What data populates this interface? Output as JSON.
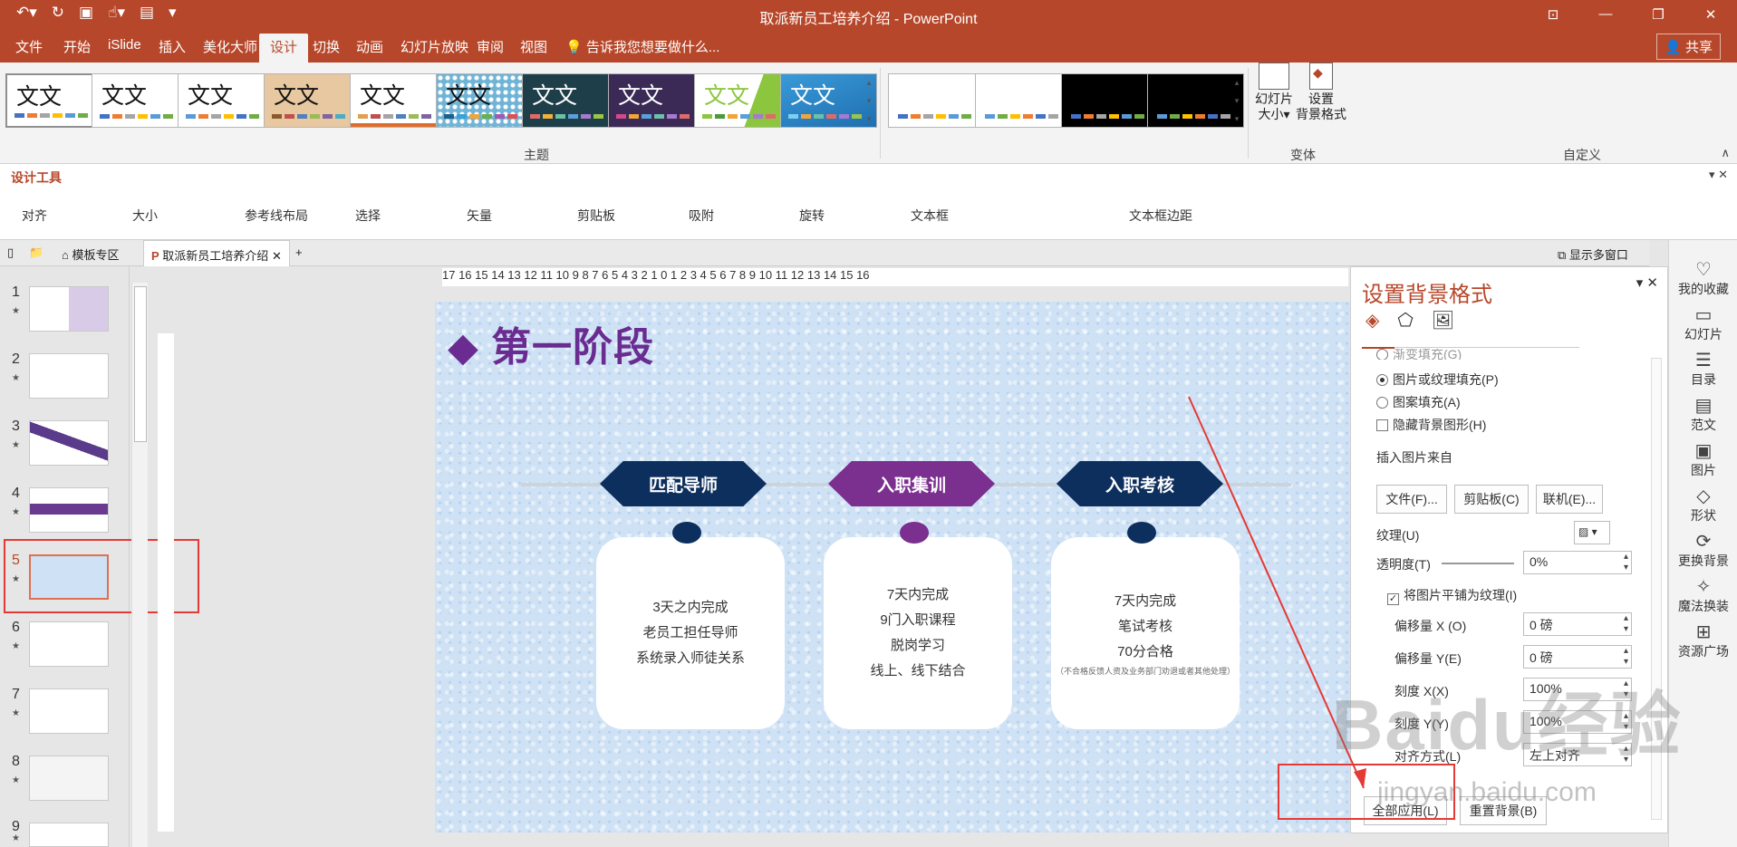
{
  "app": {
    "title": "取派新员工培养介绍 - PowerPoint"
  },
  "menu": {
    "tabs": [
      "文件",
      "开始",
      "iSlide",
      "插入",
      "美化大师",
      "设计",
      "切换",
      "动画",
      "幻灯片放映",
      "审阅",
      "视图"
    ],
    "tell_me": "告诉我您想要做什么...",
    "share": "共享"
  },
  "ribbon": {
    "theme_text": "文文",
    "groups": {
      "themes": "主题",
      "variants": "变体",
      "customize": "自定义"
    },
    "slide_size": {
      "line1": "幻灯片",
      "line2": "大小"
    },
    "format_bg": {
      "line1": "设置",
      "line2": "背景格式"
    }
  },
  "design_tools": {
    "header": "设计工具",
    "items": [
      "对齐",
      "大小",
      "参考线布局",
      "选择",
      "矢量",
      "剪贴板",
      "吸附",
      "旋转",
      "文本框",
      "文本框边距"
    ]
  },
  "doc_tabs": {
    "template": "模板专区",
    "file": "取派新员工培养介绍",
    "multi_window": "显示多窗口"
  },
  "thumbnails": [
    "1",
    "2",
    "3",
    "4",
    "5",
    "6",
    "7",
    "8",
    "9"
  ],
  "ruler": {
    "h_labels": "17 16 15 14 13 12 11 10 9 8 7 6 5 4 3 2 1 0 1 2 3 4 5 6 7 8 9 10 11 12 13 14 15 16"
  },
  "slide": {
    "title": "◆ 第一阶段",
    "stages": [
      {
        "label": "匹配导师",
        "lines": [
          "3天之内完成",
          "老员工担任导师",
          "系统录入师徒关系"
        ],
        "note": ""
      },
      {
        "label": "入职集训",
        "lines": [
          "7天内完成",
          "9门入职课程",
          "脱岗学习",
          "线上、线下结合"
        ],
        "note": ""
      },
      {
        "label": "入职考核",
        "lines": [
          "7天内完成",
          "笔试考核",
          "70分合格"
        ],
        "note": "（不合格反馈人资及业务部门劝退或者其他处理）"
      }
    ]
  },
  "format_pane": {
    "title": "设置背景格式",
    "gradient_fill": "渐变填充(G)",
    "picture_fill": "图片或纹理填充(P)",
    "pattern_fill": "图案填充(A)",
    "hide_bg": "隐藏背景图形(H)",
    "insert_from": "插入图片来自",
    "btn_file": "文件(F)...",
    "btn_clipboard": "剪贴板(C)",
    "btn_online": "联机(E)...",
    "texture": "纹理(U)",
    "transparency": "透明度(T)",
    "transparency_value": "0%",
    "tile": "将图片平铺为纹理(I)",
    "offset_x": "偏移量 X (O)",
    "offset_x_value": "0 磅",
    "offset_y": "偏移量 Y(E)",
    "offset_y_value": "0 磅",
    "scale_x": "刻度 X(X)",
    "scale_x_value": "100%",
    "scale_y": "刻度 Y(Y)",
    "scale_y_value": "100%",
    "align": "对齐方式(L)",
    "align_value": "左上对齐",
    "apply_all": "全部应用(L)",
    "reset": "重置背景(B)"
  },
  "right_rail": [
    "我的收藏",
    "幻灯片",
    "目录",
    "范文",
    "图片",
    "形状",
    "更换背景",
    "魔法换装",
    "资源广场"
  ],
  "watermark": {
    "main": "Baidu经验",
    "sub": "jingyan.baidu.com"
  },
  "colors": {
    "accent": "#b7472a",
    "navy": "#0d2f5e",
    "purple": "#7b2f8f",
    "annotation_red": "#e53935"
  }
}
